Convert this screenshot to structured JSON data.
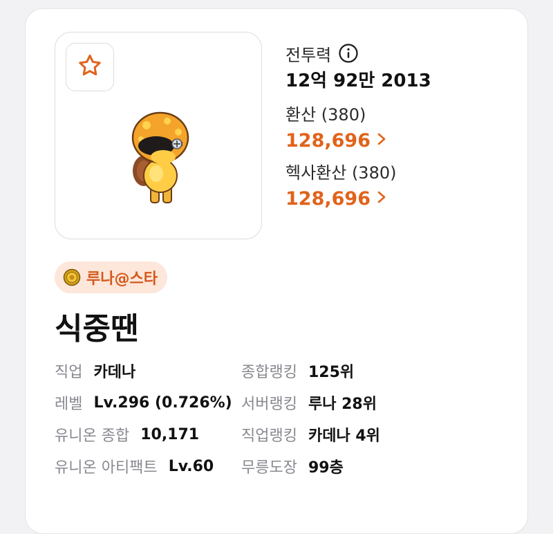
{
  "power": {
    "label": "전투력",
    "value": "12억 92만 2013"
  },
  "conversion": {
    "label": "환산 (380)",
    "value": "128,696"
  },
  "hexa_conversion": {
    "label": "헥사환산 (380)",
    "value": "128,696"
  },
  "server": {
    "name": "루나@스타"
  },
  "character": {
    "name": "식중땐"
  },
  "details": [
    {
      "label": "직업",
      "value": "카데나"
    },
    {
      "label": "종합랭킹",
      "value": "125위"
    },
    {
      "label": "레벨",
      "value": "Lv.296 (0.726%)"
    },
    {
      "label": "서버랭킹",
      "value": "루나 28위"
    },
    {
      "label": "유니온 종합",
      "value": "10,171"
    },
    {
      "label": "직업랭킹",
      "value": "카데나 4위"
    },
    {
      "label": "유니온 아티팩트",
      "value": "Lv.60"
    },
    {
      "label": "무릉도장",
      "value": "99층"
    }
  ],
  "icons": {
    "favorite": "star-outline-icon",
    "info": "info-circle-icon",
    "chevron": "chevron-right-icon",
    "server": "coin-icon"
  },
  "colors": {
    "accent": "#e0631b",
    "badge_bg": "#fde6da"
  }
}
